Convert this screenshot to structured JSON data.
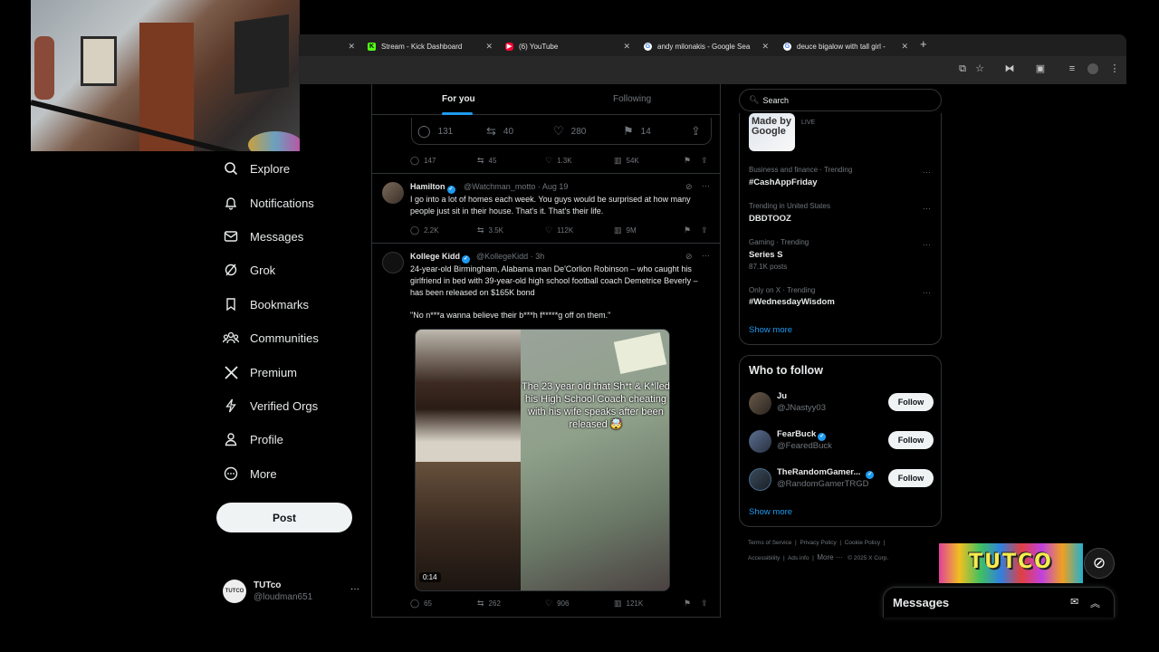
{
  "browser": {
    "tabs": [
      {
        "title": "",
        "favicon": "blank-favicon",
        "color": "#1f1f1f"
      },
      {
        "title": "Stream - Kick Dashboard",
        "favicon": "kick-favicon",
        "color": "#53fc18"
      },
      {
        "title": "(6) YouTube",
        "favicon": "youtube-favicon",
        "color": "#ff0033"
      },
      {
        "title": "andy milonakis - Google Sea",
        "favicon": "google-favicon",
        "color": "#4285f4"
      },
      {
        "title": "deuce bigalow with tall girl -",
        "favicon": "google-favicon",
        "color": "#4285f4"
      }
    ],
    "new_tab": "+"
  },
  "nav": {
    "items": [
      {
        "label": "Explore",
        "icon": "search-icon"
      },
      {
        "label": "Notifications",
        "icon": "bell-icon"
      },
      {
        "label": "Messages",
        "icon": "envelope-icon"
      },
      {
        "label": "Grok",
        "icon": "grok-icon"
      },
      {
        "label": "Bookmarks",
        "icon": "bookmark-icon"
      },
      {
        "label": "Communities",
        "icon": "people-icon"
      },
      {
        "label": "Premium",
        "icon": "x-logo-icon"
      },
      {
        "label": "Verified Orgs",
        "icon": "lightning-icon"
      },
      {
        "label": "Profile",
        "icon": "person-icon"
      },
      {
        "label": "More",
        "icon": "more-circle-icon"
      }
    ],
    "post_label": "Post",
    "account": {
      "name": "TUTco",
      "handle": "@loudman651",
      "avatar_text": "TUTCO",
      "more": "···"
    }
  },
  "timeline": {
    "tabs": {
      "for_you": "For you",
      "following": "Following"
    },
    "quoted_actions": {
      "replies": "131",
      "reposts": "40",
      "likes": "280",
      "bookmarks": "14"
    },
    "first_actions": {
      "replies": "147",
      "reposts": "45",
      "likes": "1.3K",
      "views": "54K"
    },
    "tweets": [
      {
        "name": "Hamilton",
        "handle": "@Watchman_motto",
        "time": "Aug 19",
        "text": "I go into a lot of homes each week. You guys would be surprised at how many people just sit in their house. That's it. That's their life.",
        "actions": {
          "replies": "2.2K",
          "reposts": "3.5K",
          "likes": "112K",
          "views": "9M"
        }
      },
      {
        "name": "Kollege Kidd",
        "handle": "@KollegeKidd",
        "time": "3h",
        "text": "24-year-old Birmingham, Alabama man De'Corlion Robinson – who caught his girlfriend in bed with 39-year-old high school football coach Demetrice Beverly – has been released on $165K bond",
        "quote": "\"No n***a wanna believe their b***h f*****g off on them.\"",
        "media_caption": "The 23 year old that Sh*t & K*lled his High School Coach cheating with his wife speaks after been released 🤯",
        "media_duration": "0:14",
        "actions": {
          "replies": "65",
          "reposts": "262",
          "likes": "906",
          "views": "121K"
        }
      }
    ]
  },
  "right": {
    "search_placeholder": "Search",
    "live": {
      "thumb_text": "Made by Google",
      "label": "LIVE"
    },
    "trends": [
      {
        "category": "Business and finance · Trending",
        "name": "#CashAppFriday",
        "posts": ""
      },
      {
        "category": "Trending in United States",
        "name": "DBDTOOZ",
        "posts": ""
      },
      {
        "category": "Gaming · Trending",
        "name": "Series S",
        "posts": "87.1K posts"
      },
      {
        "category": "Only on X · Trending",
        "name": "#WednesdayWisdom",
        "posts": ""
      }
    ],
    "trend_more": "···",
    "show_more": "Show more",
    "who_to_follow": {
      "title": "Who to follow",
      "users": [
        {
          "name": "Ju",
          "handle": "@JNastyy03",
          "verified": false,
          "button": "Follow"
        },
        {
          "name": "FearBuck",
          "handle": "@FearedBuck",
          "verified": true,
          "button": "Follow"
        },
        {
          "name": "TheRandomGamer...",
          "handle": "@RandomGamerTRGD",
          "verified": true,
          "button": "Follow"
        }
      ],
      "show_more": "Show more"
    },
    "footer": {
      "line1": [
        "Terms of Service",
        "Privacy Policy",
        "Cookie Policy"
      ],
      "line2": [
        "Accessibility",
        "Ads info",
        "More ···",
        "© 2025 X Corp."
      ]
    }
  },
  "messages_drawer": {
    "title": "Messages"
  },
  "overlay": {
    "tutco_text": "TUTCO"
  }
}
